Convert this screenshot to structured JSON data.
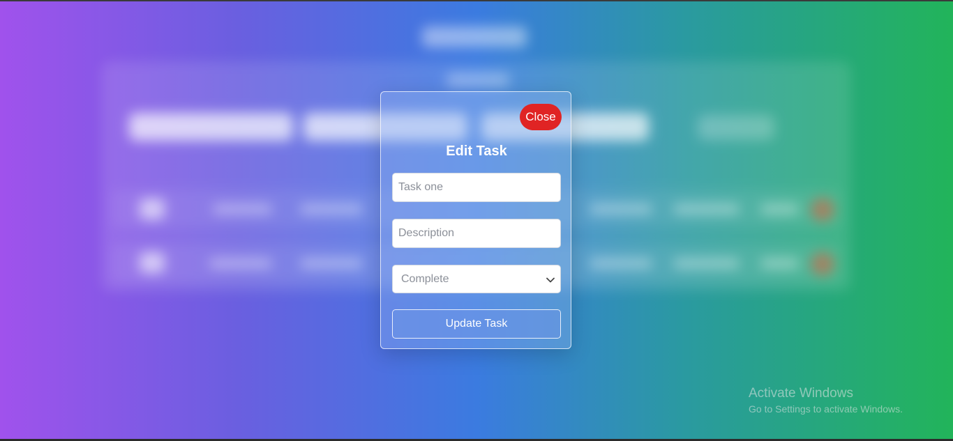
{
  "modal": {
    "title": "Edit Task",
    "close_label": "Close",
    "title_placeholder": "Task one",
    "description_placeholder": "Description",
    "status_selected": "Complete",
    "submit_label": "Update Task"
  },
  "watermark": {
    "title": "Activate Windows",
    "subtitle": "Go to Settings to activate Windows."
  },
  "colors": {
    "close_button": "#e02424",
    "gradient_left": "#a052ec",
    "gradient_right": "#22b45a"
  },
  "icons": {
    "select_chevron": "chevron-down-icon"
  }
}
